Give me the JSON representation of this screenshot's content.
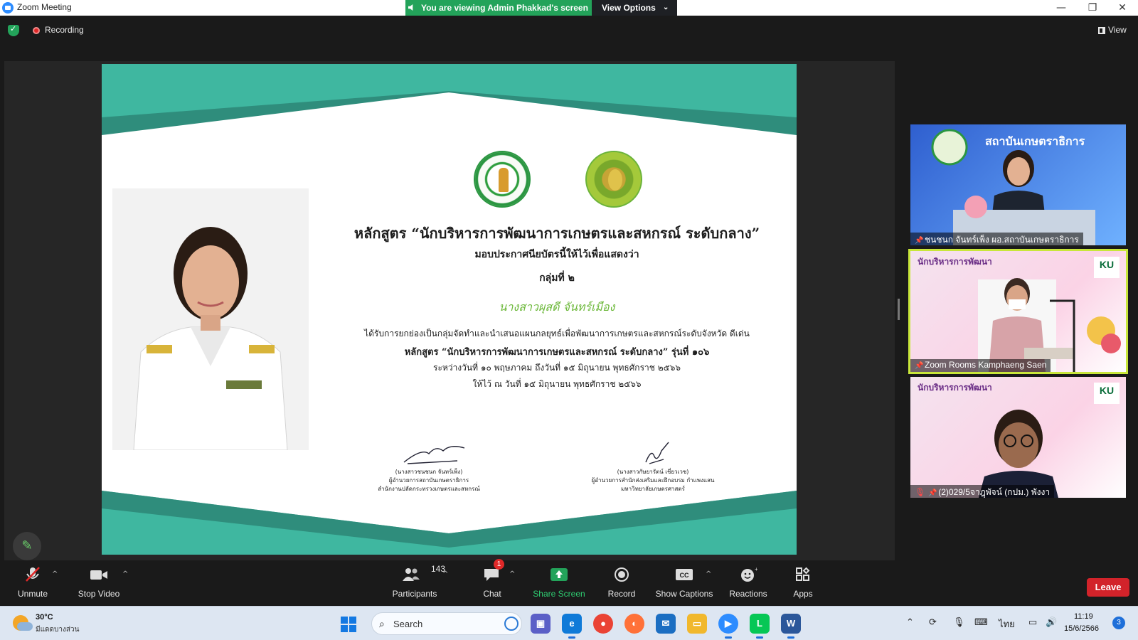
{
  "window": {
    "title": "Zoom Meeting",
    "minimize": "—",
    "maximize": "❐",
    "close": "✕"
  },
  "banner": {
    "viewing_text": "You are viewing Admin Phakkad's screen",
    "view_options": "View Options",
    "chevron": "⌄"
  },
  "status": {
    "recording": "Recording",
    "view": "View"
  },
  "certificate": {
    "course_title": "หลักสูตร “นักบริหารการพัฒนาการเกษตรและสหกรณ์ ระดับกลาง”",
    "given_line": "มอบประกาศนียบัตรนี้ให้ไว้เพื่อแสดงว่า",
    "group": "กลุ่มที่ ๒",
    "recipient": "นางสาวผุสดี  จันทร์เมือง",
    "description": "ได้รับการยกย่องเป็นกลุ่มจัดทำและนำเสนอแผนกลยุทธ์เพื่อพัฒนาการเกษตรและสหกรณ์ระดับจังหวัด ดีเด่น",
    "course_batch": "หลักสูตร “นักบริหารการพัฒนาการเกษตรและสหกรณ์ ระดับกลาง” รุ่นที่ ๑๐๖",
    "period": "ระหว่างวันที่ ๑๐ พฤษภาคม ถึงวันที่ ๑๕ มิถุนายน พุทธศักราช ๒๕๖๖",
    "issued": "ให้ไว้ ณ วันที่ ๑๕ มิถุนายน พุทธศักราช ๒๕๖๖",
    "signer1": {
      "name": "(นางสาวชนชนก จันทร์เพ็ง)",
      "title1": "ผู้อำนวยการสถาบันเกษตราธิการ",
      "title2": "สำนักงานปลัดกระทรวงเกษตรและสหกรณ์"
    },
    "signer2": {
      "name": "(นางสาวกัษยารัตน์ เชี่ยวเวช)",
      "title1": "ผู้อำนวยการสำนักส่งเสริมและฝึกอบรม กำแพงแสน",
      "title2": "มหาวิทยาลัยเกษตรศาสตร์"
    }
  },
  "gallery": [
    {
      "name": "ชนชนก จันทร์เพ็ง ผอ.สถาบันเกษตราธิการ",
      "backdrop": "สถาบันเกษตราธิการ",
      "pinned": true
    },
    {
      "name": "Zoom Rooms Kamphaeng Saen",
      "backdrop": "นักบริหารการพัฒนา",
      "logo": "KU",
      "pinned": true,
      "active_speaker": true
    },
    {
      "name": "(2)029/5จาฎุพัจน์ (กปม.) พังงา",
      "backdrop": "นักบริหารการพัฒนา",
      "logo": "KU",
      "pinned": true,
      "muted": true
    }
  ],
  "toolbar": {
    "unmute": "Unmute",
    "stop_video": "Stop Video",
    "participants": "Participants",
    "participants_count": "143",
    "chat": "Chat",
    "chat_badge": "1",
    "share_screen": "Share Screen",
    "record": "Record",
    "show_captions": "Show Captions",
    "reactions": "Reactions",
    "apps": "Apps",
    "leave": "Leave",
    "caret": "^"
  },
  "taskbar": {
    "temperature": "30°C",
    "condition": "มีแดดบางส่วน",
    "search": "Search",
    "lang": "ไทย",
    "time": "11:19",
    "date": "15/6/2566",
    "notifications": "3"
  },
  "colors": {
    "zoom_blue": "#2d8cff",
    "share_green": "#23a35a",
    "leave_red": "#d2232a",
    "cert_teal": "#3fb7a0",
    "active_speaker": "#c8e63a"
  }
}
